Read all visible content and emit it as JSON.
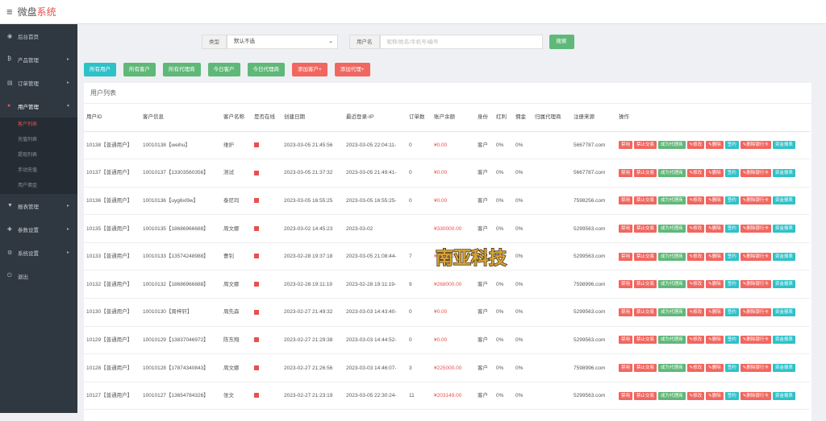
{
  "header": {
    "title_a": "微盘",
    "title_b": "系统"
  },
  "sidebar": {
    "items": [
      {
        "label": "后台首页",
        "icon": "dashboard-icon"
      },
      {
        "label": "产品管理",
        "icon": "bitcoin-icon"
      },
      {
        "label": "订单管理",
        "icon": "document-icon"
      },
      {
        "label": "用户管理",
        "icon": "user-icon"
      },
      {
        "label": "报表管理",
        "icon": "filter-icon"
      },
      {
        "label": "参数设置",
        "icon": "gamepad-icon"
      },
      {
        "label": "系统设置",
        "icon": "gears-icon"
      },
      {
        "label": "退出",
        "icon": "power-icon"
      }
    ],
    "submenu": [
      "客户列表",
      "充值列表",
      "提现列表",
      "手动充值",
      "用户佣金"
    ]
  },
  "search": {
    "type_label": "类型",
    "type_value": "默认不选",
    "user_label": "用户名",
    "user_placeholder": "昵称/姓名/手机号/编号",
    "search_btn": "搜索"
  },
  "filters": [
    "所有用户",
    "所有客户",
    "所有代理商",
    "今日客户",
    "今日代理商",
    "添加客户+",
    "添加代理+"
  ],
  "panel_title": "用户列表",
  "columns": [
    "用户ID",
    "客户信息",
    "客户名称",
    "是否在线",
    "创建日期",
    "最近登录-IP",
    "订单数",
    "账户余额",
    "身份",
    "红利",
    "佣金",
    "归属代理商",
    "注册来源",
    "操作"
  ],
  "ops": [
    "禁用",
    "禁止交易",
    "成为代理商",
    "✎修改",
    "✎删除",
    "签约",
    "✎删除银行卡",
    "资金报表"
  ],
  "rows": [
    {
      "id": "10138【普通用户】",
      "info": "10010138【weihu】",
      "name": "维护",
      "created": "2023-03-05 21:45:56",
      "login": "2023-03-05 22:04:11-",
      "orders": "0",
      "balance": "¥0.00",
      "role": "客户",
      "bonus": "0%",
      "comm": "0%",
      "agent": "",
      "source": "5667787.com"
    },
    {
      "id": "10137【普通用户】",
      "info": "10010137【13303560356】",
      "name": "测试",
      "created": "2023-03-05 21:37:32",
      "login": "2023-03-05 21:49:41-",
      "orders": "0",
      "balance": "¥0.00",
      "role": "客户",
      "bonus": "0%",
      "comm": "0%",
      "agent": "",
      "source": "5667787.com"
    },
    {
      "id": "10136【普通用户】",
      "info": "10010136【uyg6xl9w】",
      "name": "泰尼玛",
      "created": "2023-03-05 16:55:25",
      "login": "2023-03-05 16:55:25-",
      "orders": "0",
      "balance": "¥0.00",
      "role": "客户",
      "bonus": "0%",
      "comm": "0%",
      "agent": "",
      "source": "7598256.com"
    },
    {
      "id": "10135【普通用户】",
      "info": "10010135【18686966688】",
      "name": "周文娜",
      "created": "2023-03-02 14:45:23",
      "login": "2023-03-02",
      "orders": "",
      "balance": "¥330000.00",
      "role": "客户",
      "bonus": "0%",
      "comm": "0%",
      "agent": "",
      "source": "5299563.com"
    },
    {
      "id": "10133【普通用户】",
      "info": "10010133【13574248988】",
      "name": "曹钊",
      "created": "2023-02-28 19:37:18",
      "login": "2023-03-05 21:08:44-",
      "orders": "7",
      "balance": "¥880000.00",
      "role": "客户",
      "bonus": "0%",
      "comm": "0%",
      "agent": "",
      "source": "5299563.com"
    },
    {
      "id": "10132【普通用户】",
      "info": "10010132【18686966888】",
      "name": "周文娜",
      "created": "2023-02-28 19:11:19",
      "login": "2023-02-28 19:11:19-",
      "orders": "9",
      "balance": "¥268000.00",
      "role": "客户",
      "bonus": "0%",
      "comm": "0%",
      "agent": "",
      "source": "7598996.com"
    },
    {
      "id": "10130【普通用户】",
      "info": "10010130【周梓轩】",
      "name": "周先森",
      "created": "2023-02-27 21:49:32",
      "login": "2023-03-03 14:43:40-",
      "orders": "0",
      "balance": "¥0.00",
      "role": "客户",
      "bonus": "0%",
      "comm": "0%",
      "agent": "",
      "source": "5299563.com"
    },
    {
      "id": "10129【普通用户】",
      "info": "10010129【13837046972】",
      "name": "陈东翔",
      "created": "2023-02-27 21:29:38",
      "login": "2023-03-03 14:44:52-",
      "orders": "0",
      "balance": "¥0.00",
      "role": "客户",
      "bonus": "0%",
      "comm": "0%",
      "agent": "",
      "source": "5299563.com"
    },
    {
      "id": "10128【普通用户】",
      "info": "10010128【17874340843】",
      "name": "周文娜",
      "created": "2023-02-27 21:26:56",
      "login": "2023-03-03 14:46:07-",
      "orders": "3",
      "balance": "¥225000.00",
      "role": "客户",
      "bonus": "0%",
      "comm": "0%",
      "agent": "",
      "source": "7598996.com"
    },
    {
      "id": "10127【普通用户】",
      "info": "10010127【13654784326】",
      "name": "张文",
      "created": "2023-02-27 21:23:19",
      "login": "2023-03-05 22:30:24-",
      "orders": "11",
      "balance": "¥203149.00",
      "role": "客户",
      "bonus": "0%",
      "comm": "0%",
      "agent": "",
      "source": "5299563.com"
    }
  ],
  "watermark": "南亚科技"
}
